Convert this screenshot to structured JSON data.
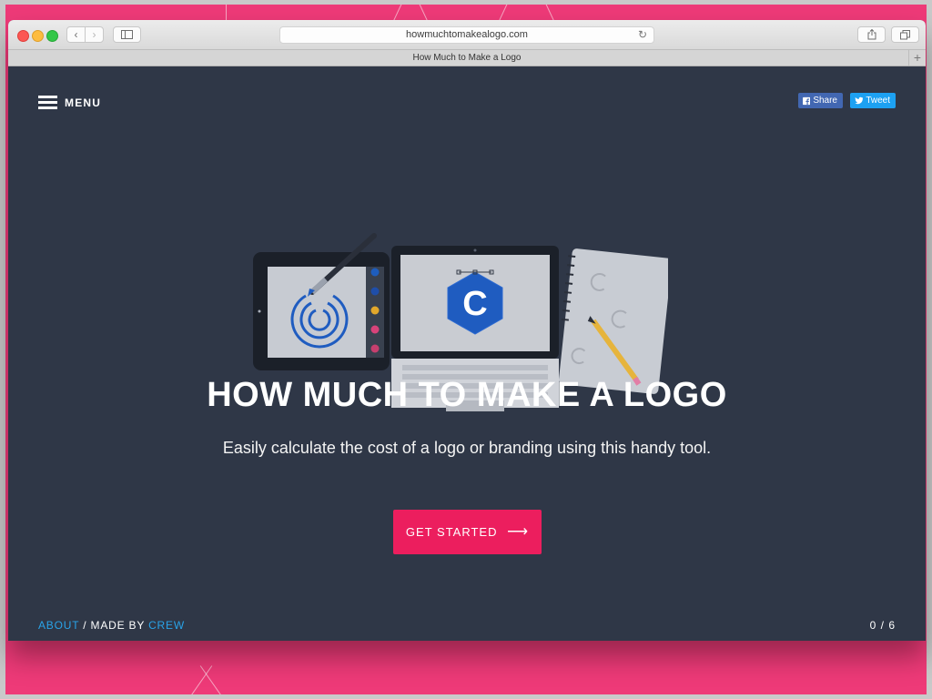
{
  "browser": {
    "url": "howmuchtomakealogo.com",
    "tab_title": "How Much to Make a Logo",
    "new_tab_label": "+"
  },
  "header": {
    "menu_label": "MENU",
    "share_label": "Share",
    "tweet_label": "Tweet"
  },
  "hero": {
    "title": "HOW MUCH TO MAKE A LOGO",
    "subtitle": "Easily calculate the cost of a logo or branding using this handy tool.",
    "cta_label": "GET STARTED",
    "cta_arrow": "⟶",
    "logo_letter": "C"
  },
  "footer": {
    "about_label": "ABOUT",
    "separator": "/ MADE BY",
    "crew_label": "CREW",
    "progress": "0 / 6"
  },
  "colors": {
    "page_background": "#ee3a78",
    "content_background": "#2f3747",
    "accent": "#ec1e5e",
    "link": "#29a3e8",
    "facebook": "#4267b2",
    "twitter": "#1da1f2"
  }
}
